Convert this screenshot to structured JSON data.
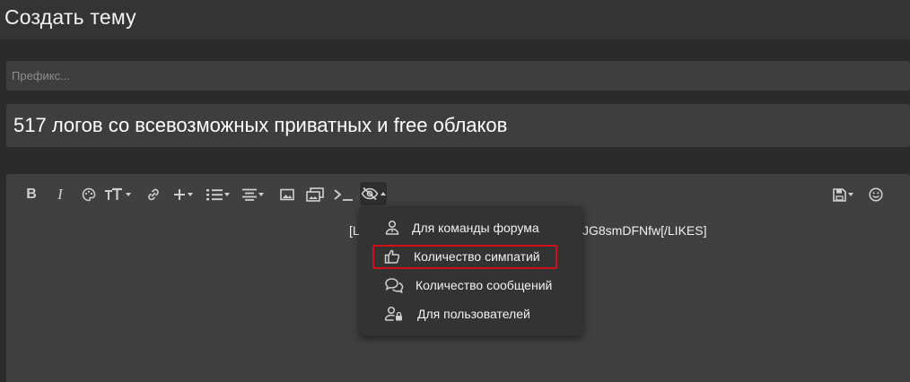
{
  "page": {
    "title": "Создать тему"
  },
  "form": {
    "prefix_placeholder": "Префикс...",
    "thread_title": "517 логов со всевозможных приватных и free облаков"
  },
  "editor": {
    "content_start": "[LI",
    "content_end": "JG8smDFNfw[/LIKES]"
  },
  "toolbar": {
    "buttons": [
      {
        "name": "bold",
        "label": "B"
      },
      {
        "name": "italic",
        "label": "I"
      },
      {
        "name": "text-color",
        "icon": "palette-icon"
      },
      {
        "name": "font-size",
        "icon": "text-size-icon"
      },
      {
        "name": "link",
        "icon": "link-icon"
      },
      {
        "name": "insert",
        "icon": "plus-icon"
      },
      {
        "name": "list",
        "icon": "list-icon"
      },
      {
        "name": "align",
        "icon": "align-icon"
      },
      {
        "name": "image",
        "icon": "image-icon"
      },
      {
        "name": "media",
        "icon": "media-icon"
      },
      {
        "name": "code",
        "icon": "terminal-icon"
      },
      {
        "name": "hide",
        "icon": "eye-slash-icon"
      },
      {
        "name": "drafts",
        "icon": "save-icon"
      },
      {
        "name": "emoji",
        "icon": "smiley-icon"
      }
    ]
  },
  "hide_menu": {
    "items": [
      {
        "label": "Для команды форума",
        "icon": "team-icon"
      },
      {
        "label": "Количество симпатий",
        "icon": "thumbs-up-icon",
        "highlighted": true
      },
      {
        "label": "Количество сообщений",
        "icon": "chat-icon"
      },
      {
        "label": "Для пользователей",
        "icon": "user-lock-icon"
      }
    ]
  },
  "colors": {
    "background": "#2b2b2b",
    "field": "#3e3e3e",
    "editor": "#404040",
    "menu": "#333333",
    "highlight": "#d0111a"
  }
}
